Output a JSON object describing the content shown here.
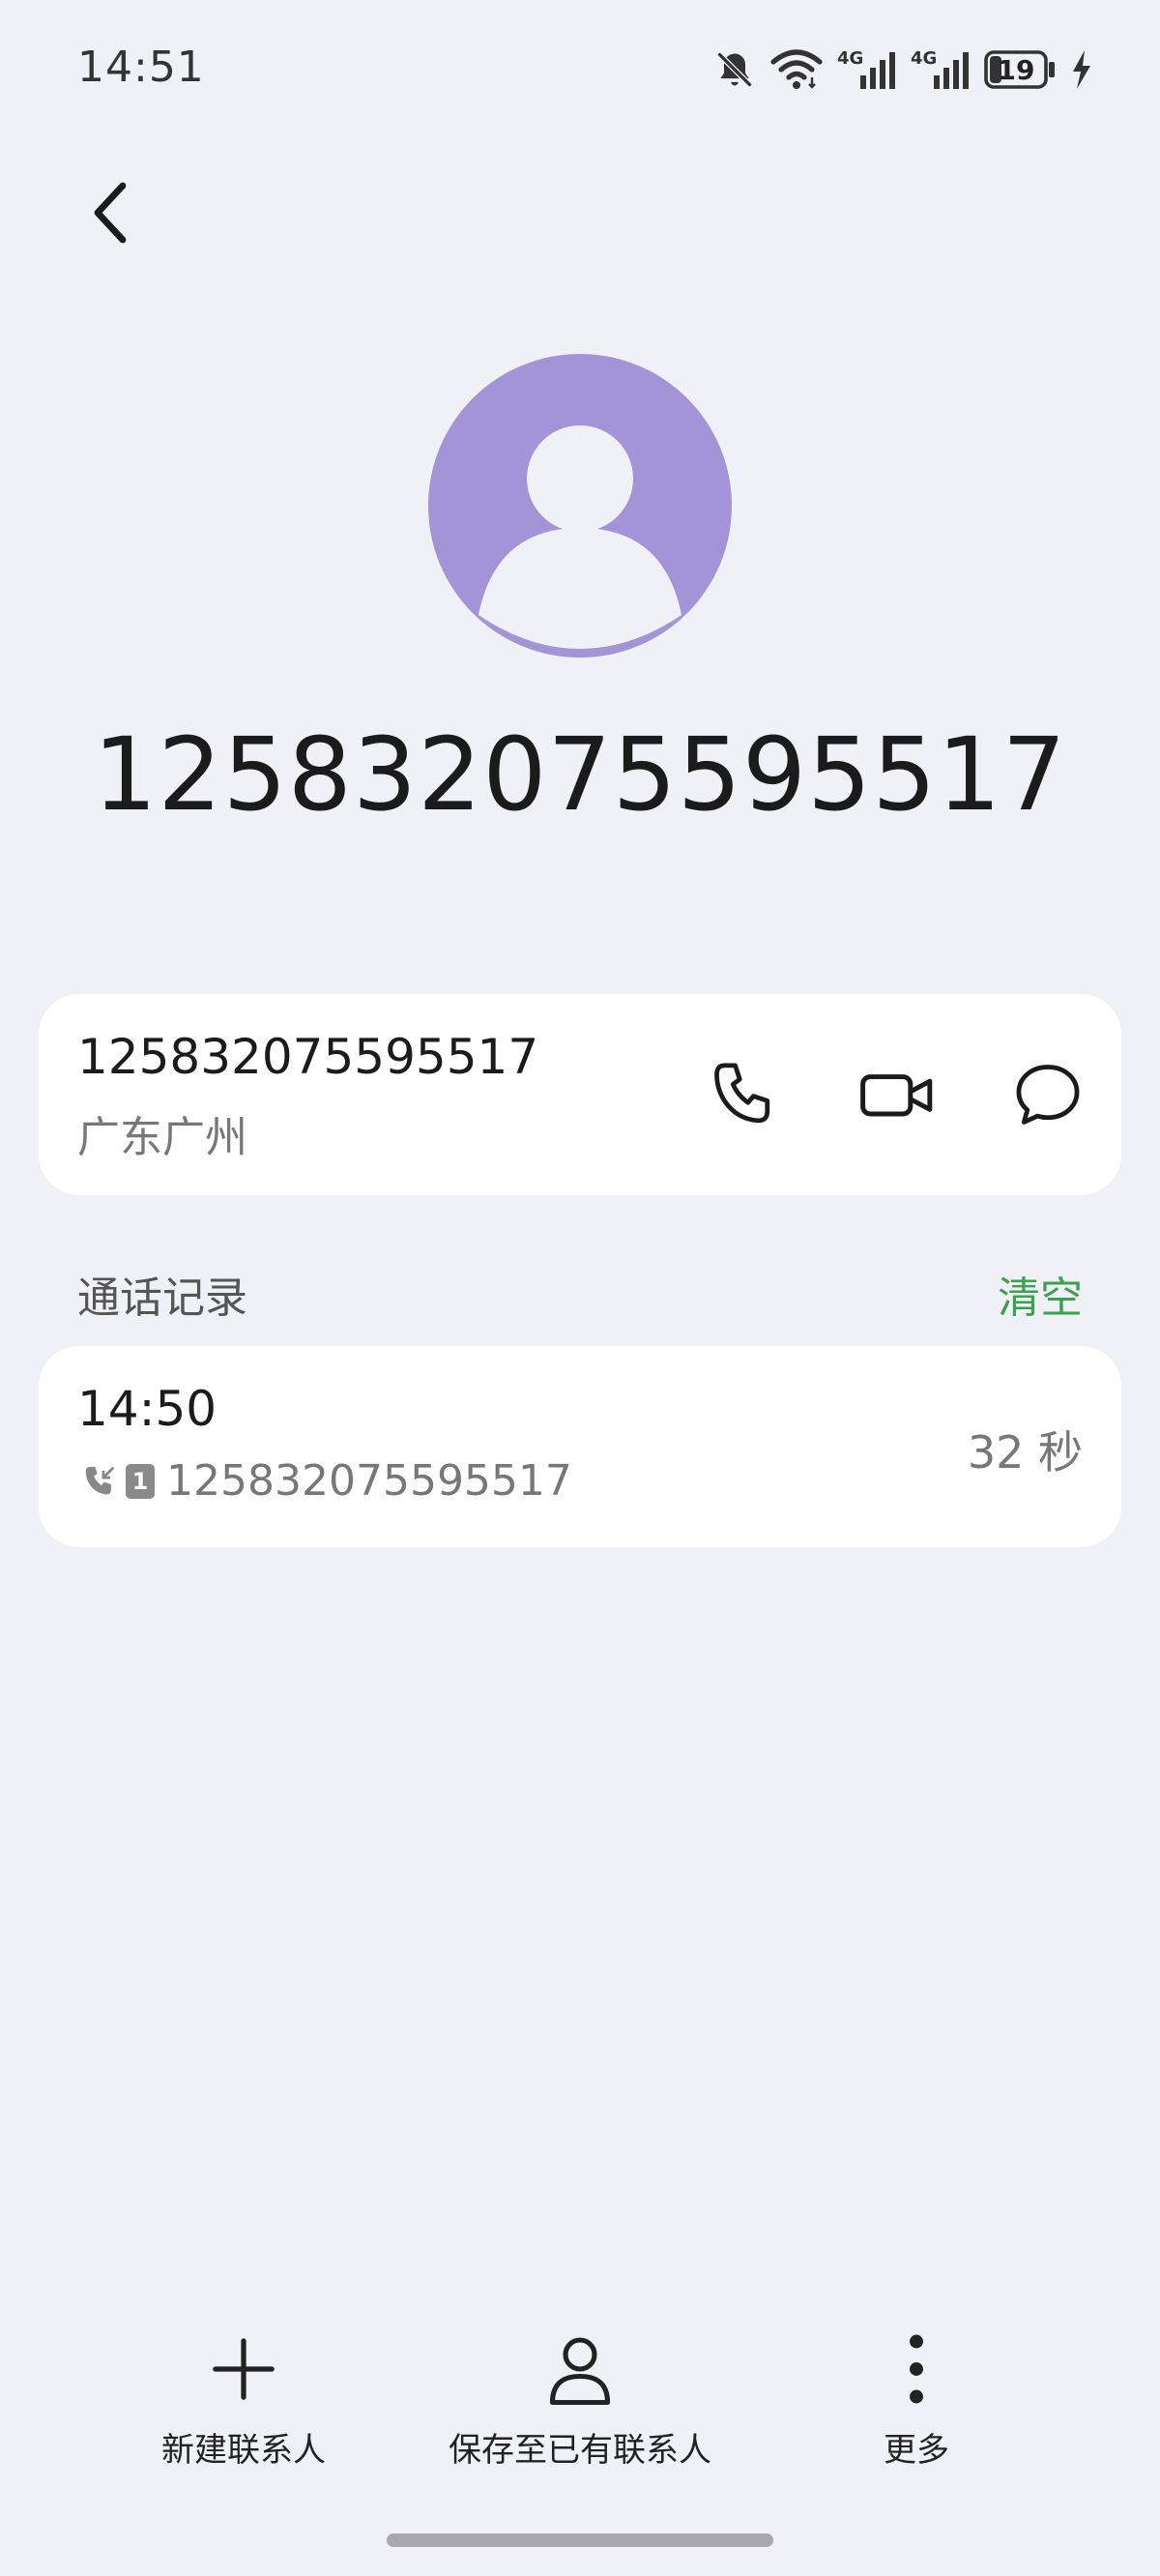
{
  "status_bar": {
    "time": "14:51",
    "battery_level": "19",
    "icons": [
      "bell-off-icon",
      "wifi-icon",
      "signal-4g-icon",
      "signal-4g-icon",
      "battery-icon",
      "charging-icon"
    ]
  },
  "header": {
    "back_icon": "chevron-left-icon"
  },
  "contact": {
    "number": "125832075595517",
    "avatar_color": "#a394d7"
  },
  "info_card": {
    "number": "125832075595517",
    "location": "广东广州",
    "actions": [
      "phone-icon",
      "video-icon",
      "message-icon"
    ]
  },
  "call_log": {
    "section_label": "通话记录",
    "clear_label": "清空",
    "entries": [
      {
        "time": "14:50",
        "sim": "1",
        "number": "125832075595517",
        "duration": "32 秒"
      }
    ]
  },
  "bottom_bar": {
    "items": [
      {
        "label": "新建联系人",
        "icon": "plus-icon"
      },
      {
        "label": "保存至已有联系人",
        "icon": "person-icon"
      },
      {
        "label": "更多",
        "icon": "more-vertical-icon"
      }
    ]
  },
  "colors": {
    "background": "#f0f1f6",
    "accent_green": "#3aa24c",
    "avatar": "#a394d7"
  }
}
